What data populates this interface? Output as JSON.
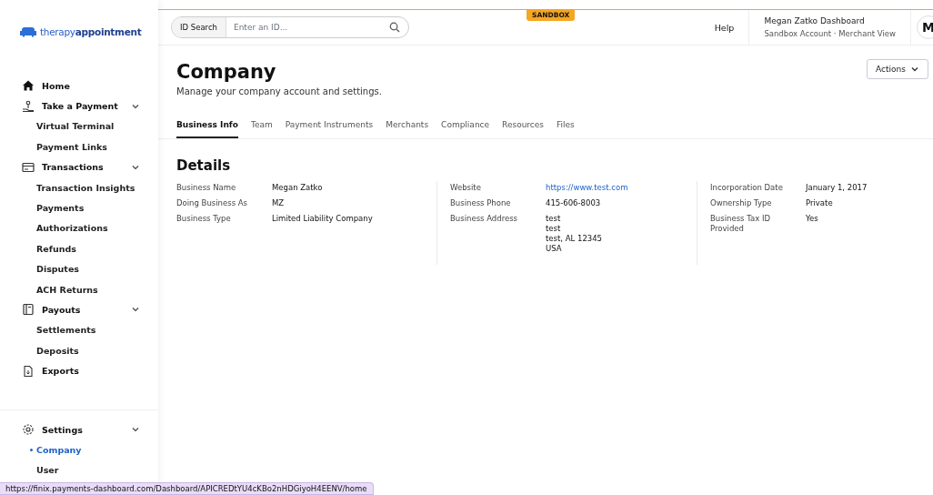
{
  "logo": "therapy**appointment**",
  "sidebar": {
    "items": [
      {
        "label": "Home",
        "kind": "section"
      },
      {
        "label": "Take a Payment",
        "kind": "section",
        "expanded": true,
        "children": [
          {
            "label": "Virtual Terminal",
            "selected": false
          },
          {
            "label": "Payment Links",
            "selected": false
          }
        ]
      },
      {
        "label": "Transactions",
        "kind": "section",
        "expanded": true,
        "children": [
          {
            "label": "Transaction Insights",
            "selected": false
          },
          {
            "label": "Payments",
            "selected": false
          },
          {
            "label": "Authorizations",
            "selected": false
          },
          {
            "label": "Refunds",
            "selected": false
          },
          {
            "label": "Disputes",
            "selected": false
          },
          {
            "label": "ACH Returns",
            "selected": false
          }
        ]
      },
      {
        "label": "Payouts",
        "kind": "section",
        "expanded": true,
        "children": [
          {
            "label": "Settlements",
            "selected": false
          },
          {
            "label": "Deposits",
            "selected": false
          }
        ]
      },
      {
        "label": "Exports",
        "kind": "section"
      }
    ],
    "footer": [
      {
        "label": "Settings",
        "kind": "section",
        "expanded": true,
        "children": [
          {
            "label": "Company",
            "selected": true
          },
          {
            "label": "User",
            "selected": false
          }
        ]
      }
    ]
  },
  "topbar": {
    "search_label": "ID Search",
    "search": {
      "placeholder": "Enter an ID..."
    },
    "badge": "SANDBOX",
    "help": "Help",
    "account": {
      "name": "Megan Zatko Dashboard",
      "sub": "Sandbox Account · Merchant View"
    },
    "avatar": "M"
  },
  "page": {
    "title": "Company",
    "subtitle": "Manage your company account and settings.",
    "actions": "Actions",
    "tabs": [
      {
        "label": "Business Info",
        "selected": true
      },
      {
        "label": "Team",
        "selected": false
      },
      {
        "label": "Payment Instruments",
        "selected": false
      },
      {
        "label": "Merchants",
        "selected": false
      },
      {
        "label": "Compliance",
        "selected": false
      },
      {
        "label": "Resources",
        "selected": false
      },
      {
        "label": "Files",
        "selected": false
      }
    ],
    "details": {
      "title": "Details",
      "columns": [
        [
          {
            "label": "Business Name",
            "value": [
              "Megan Zatko"
            ]
          },
          {
            "label": "Doing Business As",
            "value": [
              "MZ"
            ]
          },
          {
            "label": "Business Type",
            "value": [
              "Limited Liability Company"
            ]
          }
        ],
        [
          {
            "label": "Website",
            "value": [
              "https://www.test.com"
            ],
            "kind": "link"
          },
          {
            "label": "Business Phone",
            "value": [
              "415-606-8003"
            ]
          },
          {
            "label": "Business Address",
            "value": [
              "test",
              "test",
              "test, AL 12345",
              "USA"
            ]
          }
        ],
        [
          {
            "label": "Incorporation Date",
            "value": [
              "January 1, 2017"
            ]
          },
          {
            "label": "Ownership Type",
            "value": [
              "Private"
            ]
          },
          {
            "label": "Business Tax ID Provided",
            "value": [
              "Yes"
            ]
          }
        ]
      ]
    }
  },
  "status_url": "https://finix.payments-dashboard.com/Dashboard/APICREDtYU4cKBo2nHDGiyoH4EENV/home"
}
